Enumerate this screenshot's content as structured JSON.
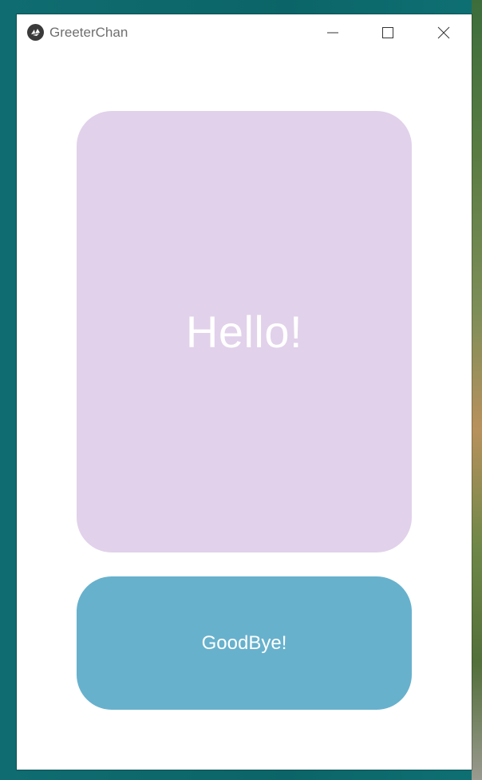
{
  "window": {
    "title": "GreeterChan",
    "app_icon": "kivy-logo-icon",
    "controls": {
      "minimize_icon": "minimize-icon",
      "maximize_icon": "maximize-icon",
      "close_icon": "close-icon"
    }
  },
  "main": {
    "greeting_label": "Hello!",
    "greeting_card_color": "#e1d1ea",
    "goodbye_button_label": "GoodBye!",
    "goodbye_button_color": "#67b1cd"
  }
}
